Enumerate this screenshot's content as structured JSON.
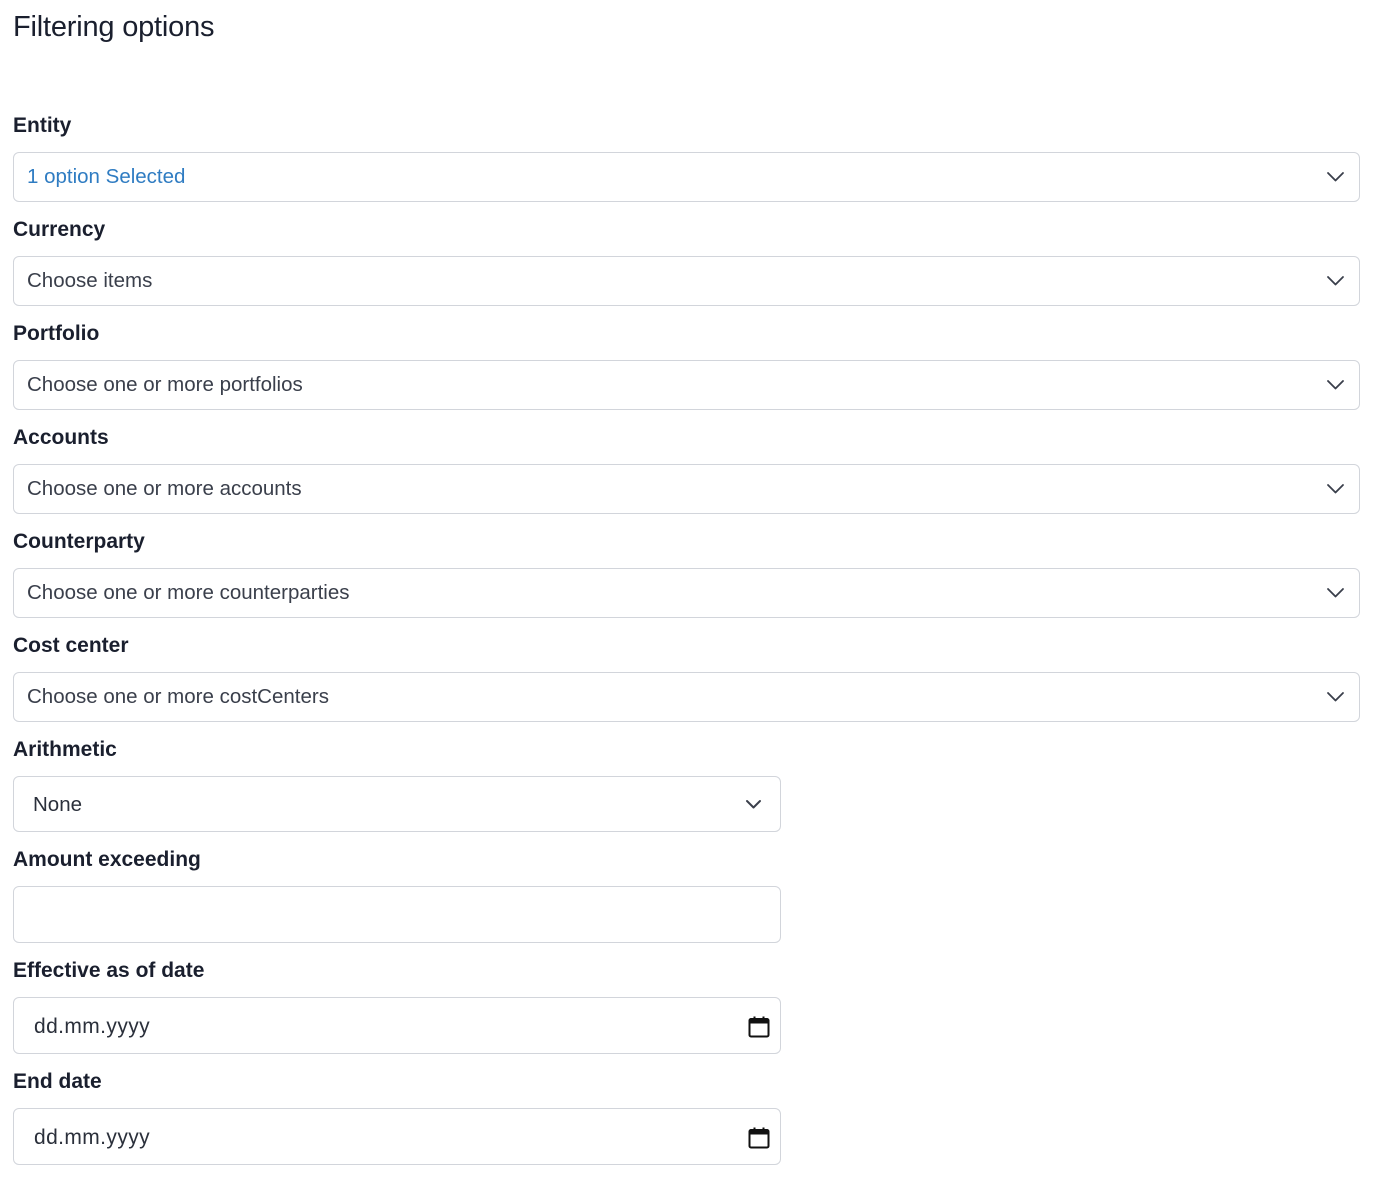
{
  "title": "Filtering options",
  "fields": {
    "entity": {
      "label": "Entity",
      "value": "1 option Selected"
    },
    "currency": {
      "label": "Currency",
      "placeholder": "Choose items"
    },
    "portfolio": {
      "label": "Portfolio",
      "placeholder": "Choose one or more portfolios"
    },
    "accounts": {
      "label": "Accounts",
      "placeholder": "Choose one or more accounts"
    },
    "counterparty": {
      "label": "Counterparty",
      "placeholder": "Choose one or more counterparties"
    },
    "cost_center": {
      "label": "Cost center",
      "placeholder": "Choose one or more costCenters"
    },
    "arithmetic": {
      "label": "Arithmetic",
      "value": "None"
    },
    "amount_exceeding": {
      "label": "Amount exceeding",
      "value": ""
    },
    "effective_date": {
      "label": "Effective as of date",
      "placeholder": "dd.mm.yyyy"
    },
    "end_date": {
      "label": "End date",
      "placeholder": "dd.mm.yyyy"
    }
  },
  "icons": {
    "dropdown": "chevron-down-icon",
    "date": "calendar-icon"
  },
  "colors": {
    "selected_text": "#2f7cc2",
    "border": "#d2d5db",
    "label_text": "#1a1f2e"
  }
}
